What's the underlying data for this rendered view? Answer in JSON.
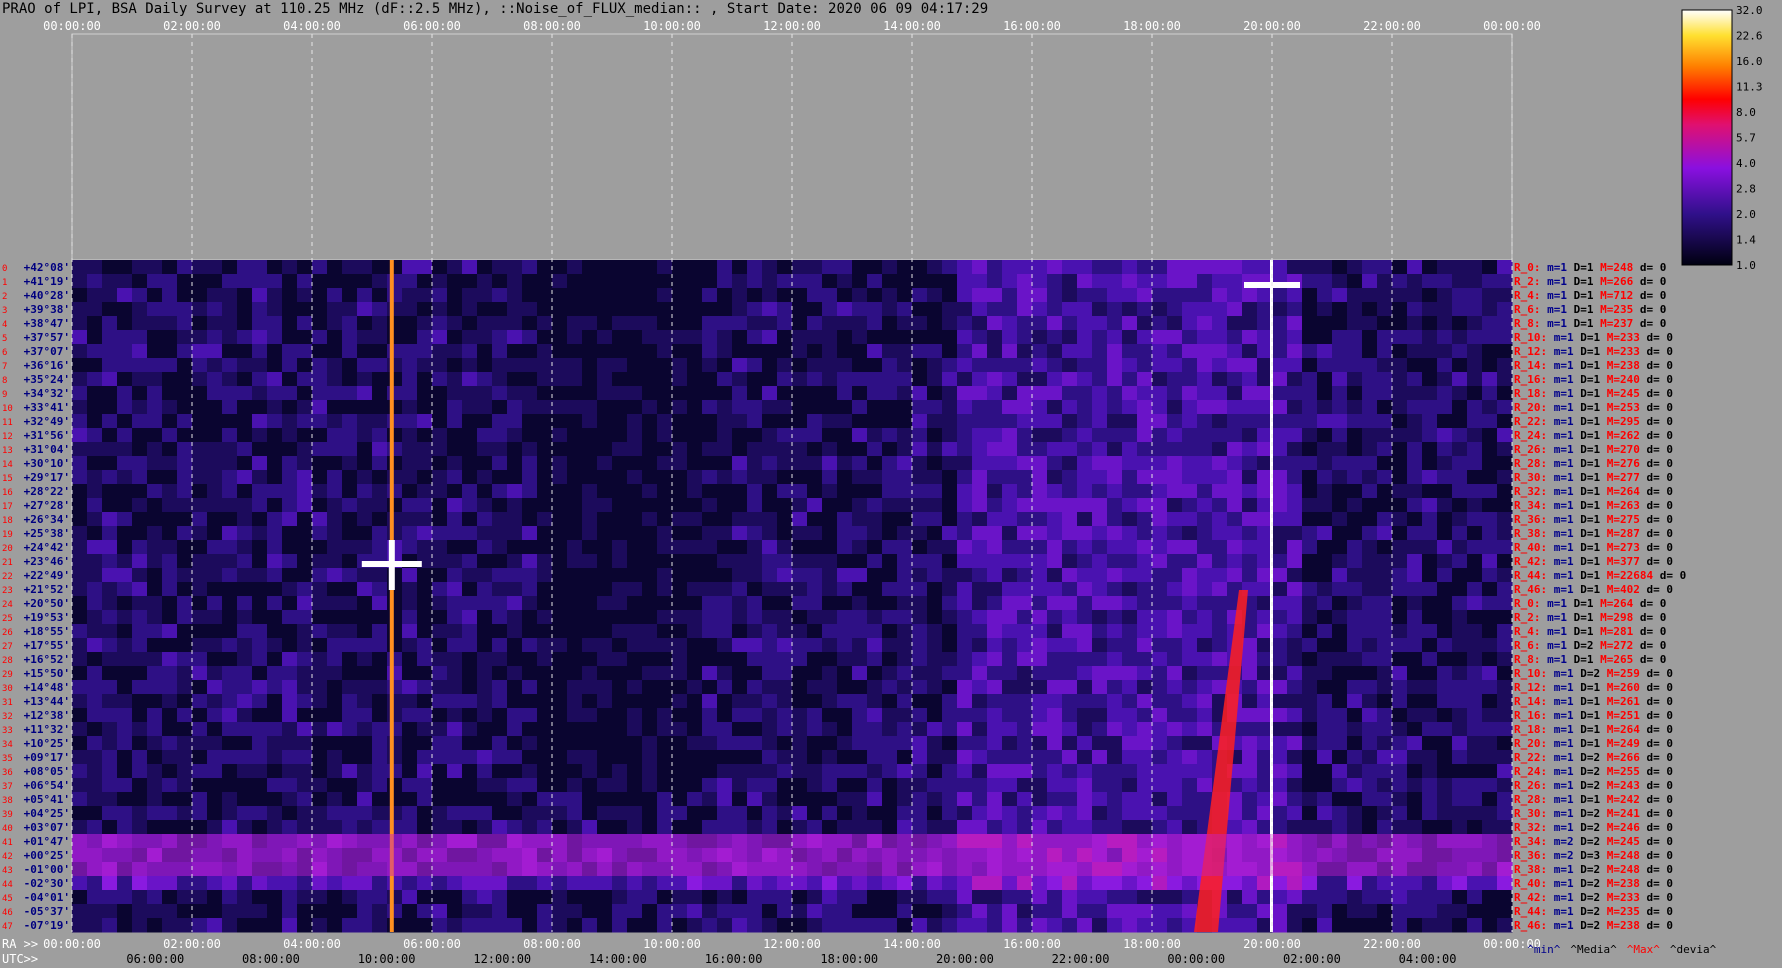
{
  "title": "PRAO of LPI, BSA Daily Survey at 110.25 MHz (dF::2.5 MHz), ::Noise_of_FLUX_median:: , Start Date: 2020 06 09 04:17:29",
  "chart_data": {
    "type": "heatmap",
    "top_time_ticks": [
      "00:00:00",
      "02:00:00",
      "04:00:00",
      "06:00:00",
      "08:00:00",
      "10:00:00",
      "12:00:00",
      "14:00:00",
      "16:00:00",
      "18:00:00",
      "20:00:00",
      "22:00:00",
      "00:00:00"
    ],
    "bottom_axis_label_ra": "RA >>",
    "bottom_ra_ticks": [
      "00:00:00",
      "02:00:00",
      "04:00:00",
      "06:00:00",
      "08:00:00",
      "10:00:00",
      "12:00:00",
      "14:00:00",
      "16:00:00",
      "18:00:00",
      "20:00:00",
      "22:00:00",
      "00:00:00"
    ],
    "bottom_axis_label_utc": "UTC>>",
    "bottom_utc_ticks": [
      "06:00:00",
      "08:00:00",
      "10:00:00",
      "12:00:00",
      "14:00:00",
      "16:00:00",
      "18:00:00",
      "20:00:00",
      "22:00:00",
      "00:00:00",
      "02:00:00",
      "04:00:00"
    ],
    "declinations": [
      "+42°08'",
      "+41°19'",
      "+40°28'",
      "+39°38'",
      "+38°47'",
      "+37°57'",
      "+37°07'",
      "+36°16'",
      "+35°24'",
      "+34°32'",
      "+33°41'",
      "+32°49'",
      "+31°56'",
      "+31°04'",
      "+30°10'",
      "+29°17'",
      "+28°22'",
      "+27°28'",
      "+26°34'",
      "+25°38'",
      "+24°42'",
      "+23°46'",
      "+22°49'",
      "+21°52'",
      "+20°50'",
      "+19°53'",
      "+18°55'",
      "+17°55'",
      "+16°52'",
      "+15°50'",
      "+14°48'",
      "+13°44'",
      "+12°38'",
      "+11°32'",
      "+10°25'",
      "+09°17'",
      "+08°05'",
      "+06°54'",
      "+05°41'",
      "+04°25'",
      "+03°07'",
      "+01°47'",
      "+00°25'",
      "-01°00'",
      "-02°30'",
      "-04°01'",
      "-05°37'",
      "-07°19'"
    ],
    "row_stats": [
      {
        "r": "R_0:",
        "m": "m=1",
        "D": "D=1",
        "M": "M=248",
        "d": "d= 0"
      },
      {
        "r": "R_2:",
        "m": "m=1",
        "D": "D=1",
        "M": "M=266",
        "d": "d= 0"
      },
      {
        "r": "R_4:",
        "m": "m=1",
        "D": "D=1",
        "M": "M=712",
        "d": "d= 0"
      },
      {
        "r": "R_6:",
        "m": "m=1",
        "D": "D=1",
        "M": "M=235",
        "d": "d= 0"
      },
      {
        "r": "R_8:",
        "m": "m=1",
        "D": "D=1",
        "M": "M=237",
        "d": "d= 0"
      },
      {
        "r": "R_10:",
        "m": "m=1",
        "D": "D=1",
        "M": "M=233",
        "d": "d= 0"
      },
      {
        "r": "R_12:",
        "m": "m=1",
        "D": "D=1",
        "M": "M=233",
        "d": "d= 0"
      },
      {
        "r": "R_14:",
        "m": "m=1",
        "D": "D=1",
        "M": "M=238",
        "d": "d= 0"
      },
      {
        "r": "R_16:",
        "m": "m=1",
        "D": "D=1",
        "M": "M=240",
        "d": "d= 0"
      },
      {
        "r": "R_18:",
        "m": "m=1",
        "D": "D=1",
        "M": "M=245",
        "d": "d= 0"
      },
      {
        "r": "R_20:",
        "m": "m=1",
        "D": "D=1",
        "M": "M=253",
        "d": "d= 0"
      },
      {
        "r": "R_22:",
        "m": "m=1",
        "D": "D=1",
        "M": "M=295",
        "d": "d= 0"
      },
      {
        "r": "R_24:",
        "m": "m=1",
        "D": "D=1",
        "M": "M=262",
        "d": "d= 0"
      },
      {
        "r": "R_26:",
        "m": "m=1",
        "D": "D=1",
        "M": "M=270",
        "d": "d= 0"
      },
      {
        "r": "R_28:",
        "m": "m=1",
        "D": "D=1",
        "M": "M=276",
        "d": "d= 0"
      },
      {
        "r": "R_30:",
        "m": "m=1",
        "D": "D=1",
        "M": "M=277",
        "d": "d= 0"
      },
      {
        "r": "R_32:",
        "m": "m=1",
        "D": "D=1",
        "M": "M=264",
        "d": "d= 0"
      },
      {
        "r": "R_34:",
        "m": "m=1",
        "D": "D=1",
        "M": "M=263",
        "d": "d= 0"
      },
      {
        "r": "R_36:",
        "m": "m=1",
        "D": "D=1",
        "M": "M=275",
        "d": "d= 0"
      },
      {
        "r": "R_38:",
        "m": "m=1",
        "D": "D=1",
        "M": "M=287",
        "d": "d= 0"
      },
      {
        "r": "R_40:",
        "m": "m=1",
        "D": "D=1",
        "M": "M=273",
        "d": "d= 0"
      },
      {
        "r": "R_42:",
        "m": "m=1",
        "D": "D=1",
        "M": "M=377",
        "d": "d= 0"
      },
      {
        "r": "R_44:",
        "m": "m=1",
        "D": "D=1",
        "M": "M=22684",
        "d": "d= 0"
      },
      {
        "r": "R_46:",
        "m": "m=1",
        "D": "D=1",
        "M": "M=402",
        "d": "d= 0"
      },
      {
        "r": "R_0:",
        "m": "m=1",
        "D": "D=1",
        "M": "M=264",
        "d": "d= 0"
      },
      {
        "r": "R_2:",
        "m": "m=1",
        "D": "D=1",
        "M": "M=298",
        "d": "d= 0"
      },
      {
        "r": "R_4:",
        "m": "m=1",
        "D": "D=1",
        "M": "M=281",
        "d": "d= 0"
      },
      {
        "r": "R_6:",
        "m": "m=1",
        "D": "D=2",
        "M": "M=272",
        "d": "d= 0"
      },
      {
        "r": "R_8:",
        "m": "m=1",
        "D": "D=1",
        "M": "M=265",
        "d": "d= 0"
      },
      {
        "r": "R_10:",
        "m": "m=1",
        "D": "D=2",
        "M": "M=259",
        "d": "d= 0"
      },
      {
        "r": "R_12:",
        "m": "m=1",
        "D": "D=1",
        "M": "M=260",
        "d": "d= 0"
      },
      {
        "r": "R_14:",
        "m": "m=1",
        "D": "D=1",
        "M": "M=261",
        "d": "d= 0"
      },
      {
        "r": "R_16:",
        "m": "m=1",
        "D": "D=1",
        "M": "M=251",
        "d": "d= 0"
      },
      {
        "r": "R_18:",
        "m": "m=1",
        "D": "D=1",
        "M": "M=264",
        "d": "d= 0"
      },
      {
        "r": "R_20:",
        "m": "m=1",
        "D": "D=1",
        "M": "M=249",
        "d": "d= 0"
      },
      {
        "r": "R_22:",
        "m": "m=1",
        "D": "D=2",
        "M": "M=266",
        "d": "d= 0"
      },
      {
        "r": "R_24:",
        "m": "m=1",
        "D": "D=2",
        "M": "M=255",
        "d": "d= 0"
      },
      {
        "r": "R_26:",
        "m": "m=1",
        "D": "D=2",
        "M": "M=243",
        "d": "d= 0"
      },
      {
        "r": "R_28:",
        "m": "m=1",
        "D": "D=1",
        "M": "M=242",
        "d": "d= 0"
      },
      {
        "r": "R_30:",
        "m": "m=1",
        "D": "D=2",
        "M": "M=241",
        "d": "d= 0"
      },
      {
        "r": "R_32:",
        "m": "m=1",
        "D": "D=2",
        "M": "M=246",
        "d": "d= 0"
      },
      {
        "r": "R_34:",
        "m": "m=2",
        "D": "D=2",
        "M": "M=245",
        "d": "d= 0"
      },
      {
        "r": "R_36:",
        "m": "m=2",
        "D": "D=3",
        "M": "M=248",
        "d": "d= 0"
      },
      {
        "r": "R_38:",
        "m": "m=1",
        "D": "D=2",
        "M": "M=248",
        "d": "d= 0"
      },
      {
        "r": "R_40:",
        "m": "m=1",
        "D": "D=2",
        "M": "M=238",
        "d": "d= 0"
      },
      {
        "r": "R_42:",
        "m": "m=1",
        "D": "D=2",
        "M": "M=233",
        "d": "d= 0"
      },
      {
        "r": "R_44:",
        "m": "m=1",
        "D": "D=2",
        "M": "M=235",
        "d": "d= 0"
      },
      {
        "r": "R_46:",
        "m": "m=1",
        "D": "D=2",
        "M": "M=238",
        "d": "d= 0"
      }
    ],
    "colorbar_ticks": [
      "32.0",
      "22.6",
      "16.0",
      "11.3",
      "8.0",
      "5.7",
      "4.0",
      "2.8",
      "2.0",
      "1.4",
      "1.0"
    ],
    "legend_footer": [
      "^min^",
      "^Media^",
      "^Max^",
      "^devia^"
    ],
    "colors": {
      "min": "#00008b",
      "media": "#000000",
      "max": "#ff0000",
      "devia": "#000000",
      "row_label": "#ff0000",
      "dec_label": "#000080"
    }
  }
}
